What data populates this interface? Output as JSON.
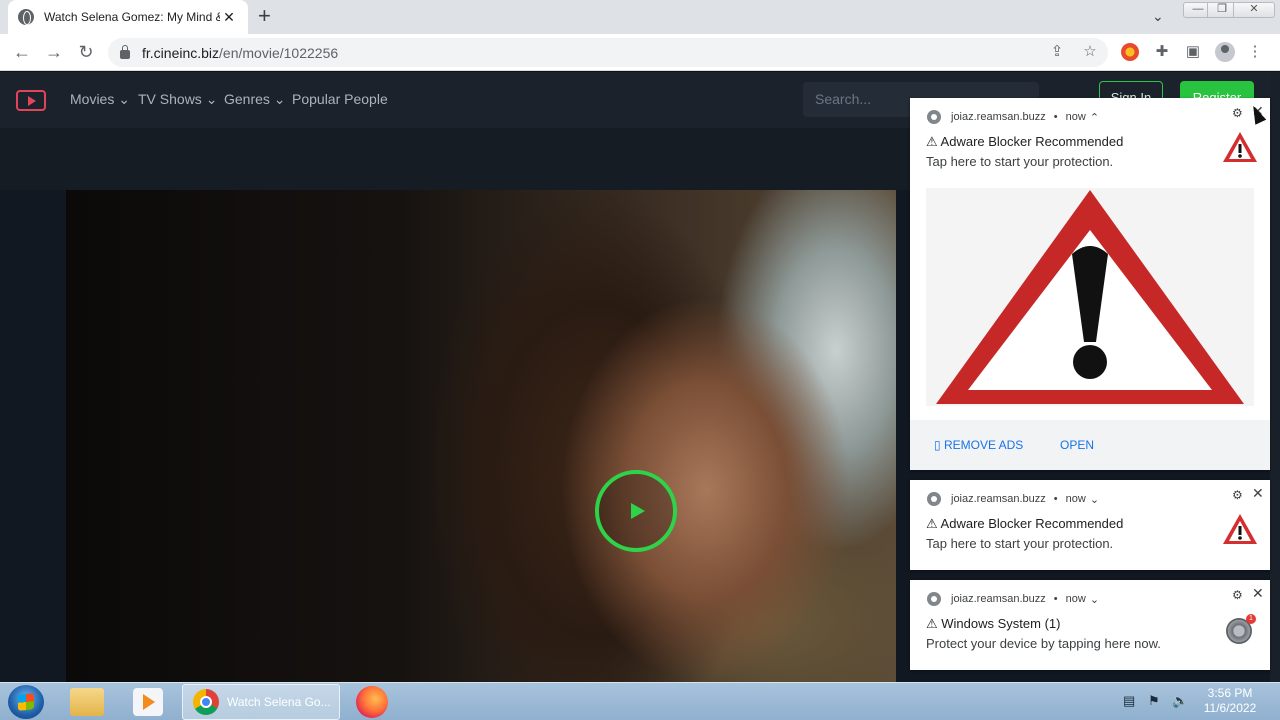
{
  "browser": {
    "tab_title": "Watch Selena Gomez: My Mind &",
    "tab_close": "✕",
    "new_tab": "+",
    "url_domain": "fr.cineinc.biz",
    "url_path": "/en/movie/1022256",
    "min_label": "—",
    "max_label": "❐",
    "close_label": "✕"
  },
  "site": {
    "nav": [
      "Movies",
      "TV Shows",
      "Genres",
      "Popular People"
    ],
    "search_placeholder": "Search...",
    "signin": "Sign In",
    "register": "Register",
    "accent": "#28c43f"
  },
  "notifications": [
    {
      "source": "joiaz.reamsan.buzz",
      "time": "now",
      "chevron": "⌃",
      "title": "⚠ Adware Blocker Recommended",
      "body": "Tap here to start your protection.",
      "actions": [
        "▯ REMOVE ADS",
        "OPEN"
      ],
      "icon": "warning-triangle-icon"
    },
    {
      "source": "joiaz.reamsan.buzz",
      "time": "now",
      "chevron": "⌄",
      "title": "⚠ Adware Blocker Recommended",
      "body": "Tap here to start your protection.",
      "icon": "warning-triangle-icon"
    },
    {
      "source": "joiaz.reamsan.buzz",
      "time": "now",
      "chevron": "⌄",
      "title": "⚠ Windows System (1)",
      "body": "Protect your device by tapping here now.",
      "badge": "1",
      "icon": "windows-system-icon"
    }
  ],
  "taskbar": {
    "chrome_task": "Watch Selena Go...",
    "time": "3:56 PM",
    "date": "11/6/2022"
  }
}
